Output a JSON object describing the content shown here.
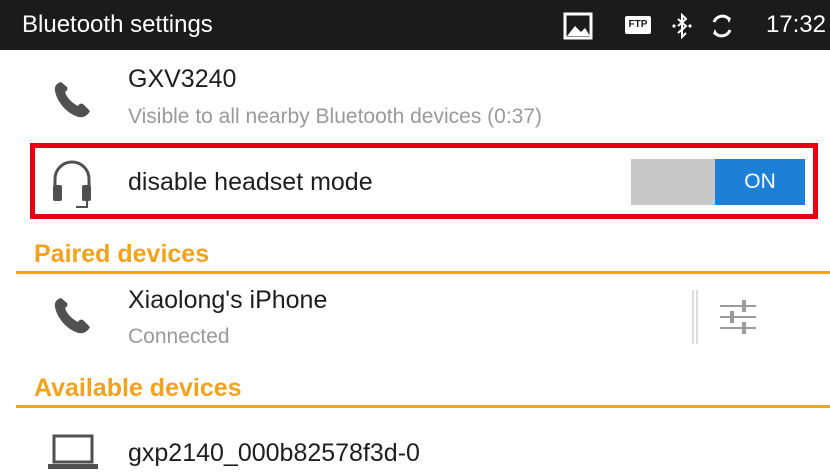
{
  "status_bar": {
    "title": "Bluetooth settings",
    "ftp_badge": "FTP",
    "time": "17:32",
    "icons": [
      "image-icon",
      "ftp-icon",
      "bluetooth-icon",
      "sync-icon"
    ]
  },
  "device": {
    "name": "GXV3240",
    "visibility": "Visible to all nearby Bluetooth devices (0:37)",
    "icon": "phone-icon"
  },
  "headset": {
    "label": "disable headset mode",
    "toggle_label": "ON",
    "toggle_on": true,
    "icon": "headset-icon"
  },
  "paired": {
    "header": "Paired devices",
    "items": [
      {
        "name": "Xiaolong's iPhone",
        "status": "Connected",
        "icon": "phone-icon"
      }
    ]
  },
  "available": {
    "header": "Available devices",
    "items": [
      {
        "name": "gxp2140_000b82578f3d-0",
        "icon": "laptop-icon"
      }
    ]
  },
  "colors": {
    "status_bar_bg": "#1b1b1b",
    "accent_orange": "#f2a21d",
    "toggle_on_blue": "#1e7fd6",
    "highlight_red": "#e60012"
  }
}
